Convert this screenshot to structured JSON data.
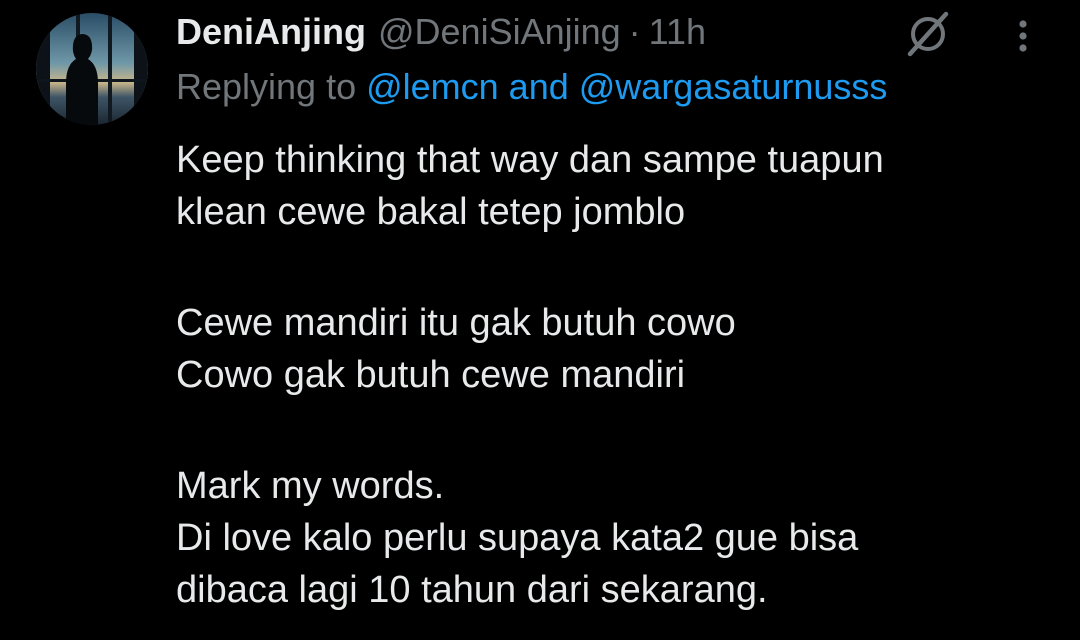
{
  "tweet": {
    "author": {
      "display_name": "DeniAnjing",
      "handle": "@DeniSiAnjing",
      "avatar_icon": "user-avatar-silhouette-window"
    },
    "separator": "·",
    "timestamp": "11h",
    "reply": {
      "prefix": "Replying to ",
      "mentions_text": "@lemcn and @wargasaturnusss"
    },
    "text": {
      "paragraph1": [
        "Keep thinking that way dan sampe tuapun",
        "klean cewe bakal tetep jomblo"
      ],
      "paragraph2": [
        "Cewe mandiri itu gak butuh cowo",
        "Cowo gak butuh cewe mandiri"
      ],
      "paragraph3": [
        "Mark my words.",
        "Di love kalo perlu supaya kata2 gue bisa",
        "dibaca lagi 10 tahun dari sekarang."
      ]
    },
    "icons": {
      "grok": "grok-icon",
      "more": "more-options-icon"
    }
  },
  "colors": {
    "background": "#000000",
    "text_primary": "#e7e9ea",
    "text_secondary": "#71767b",
    "link": "#1d9bf0"
  }
}
